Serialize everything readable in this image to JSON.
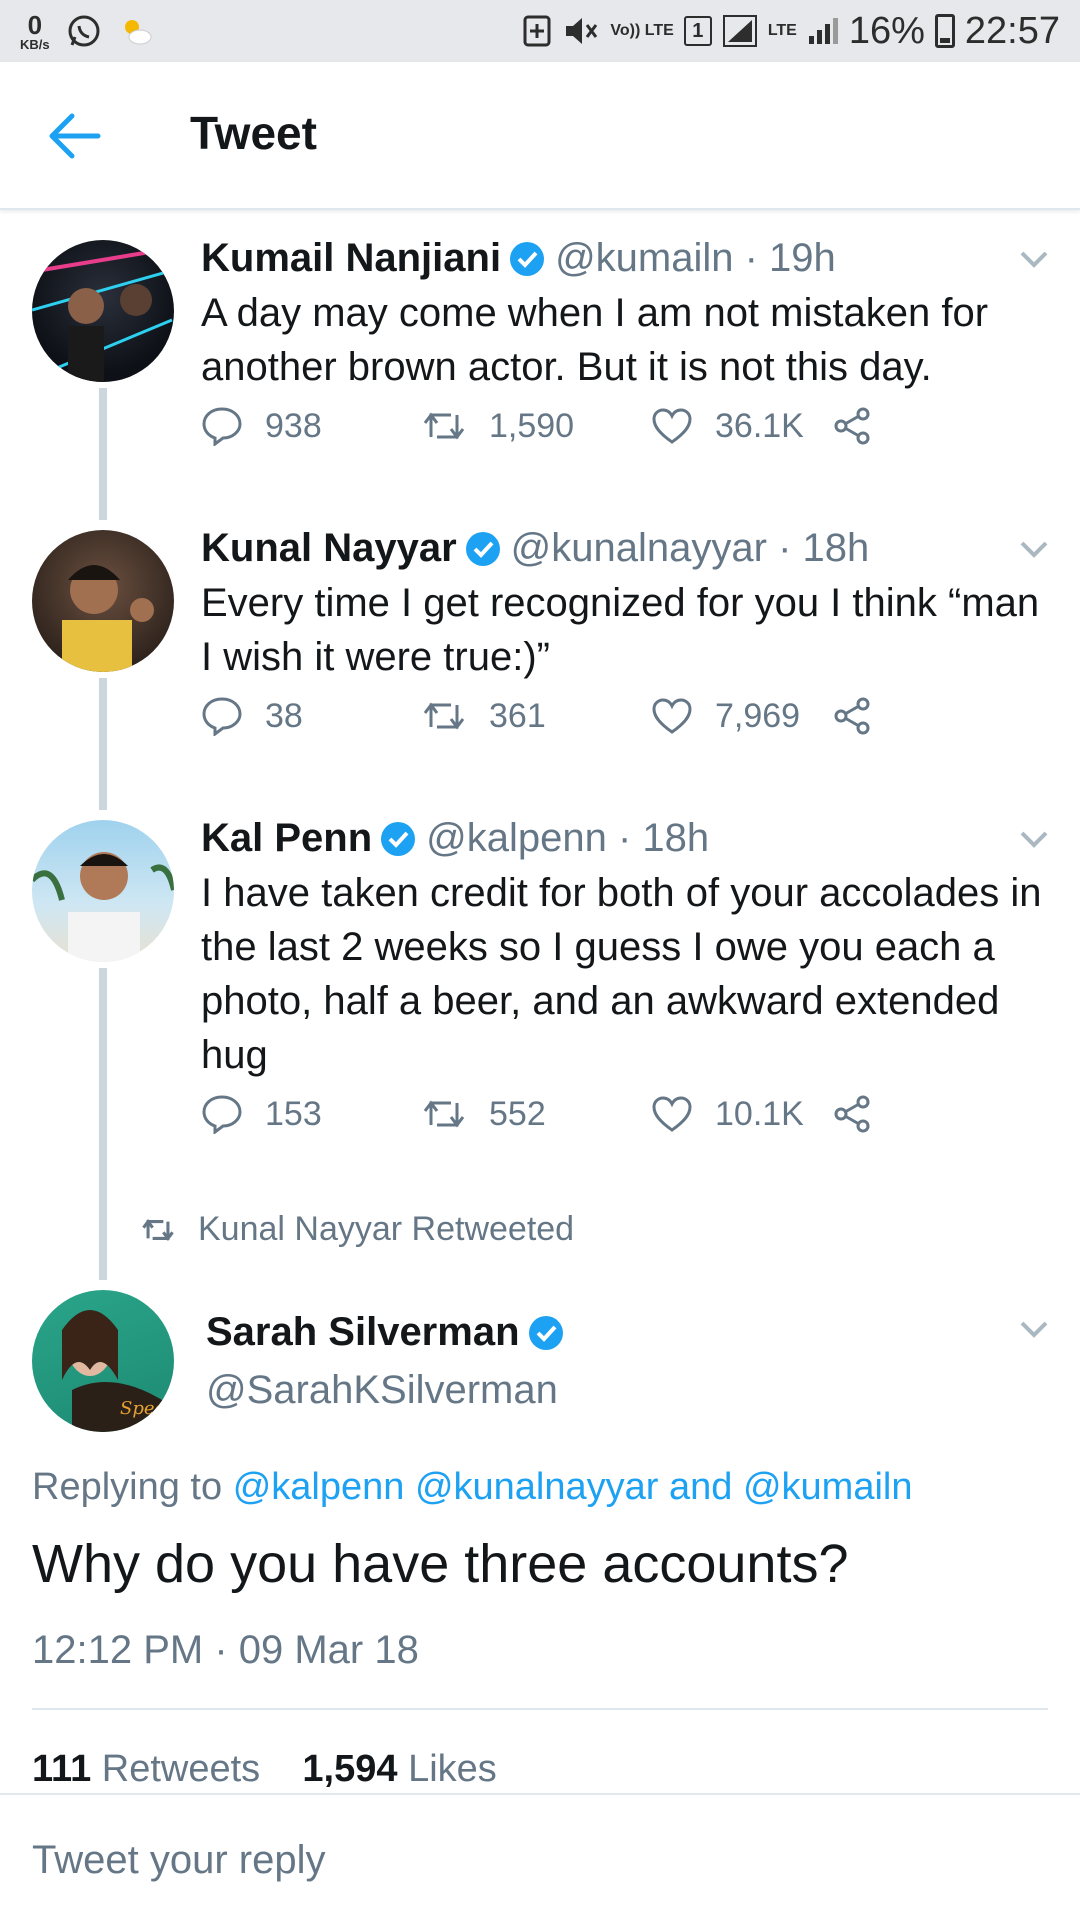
{
  "status_bar": {
    "net_speed_value": "0",
    "net_speed_unit": "KB/s",
    "volte": "Vo)) LTE",
    "sim": "1",
    "network": "LTE",
    "battery": "16%",
    "time": "22:57"
  },
  "header": {
    "title": "Tweet"
  },
  "thread": [
    {
      "name": "Kumail Nanjiani",
      "handle": "@kumailn · 19h",
      "text": "A day may come when I am not mistaken for another brown actor. But it is not this day.",
      "replies": "938",
      "retweets": "1,590",
      "likes": "36.1K"
    },
    {
      "name": "Kunal Nayyar",
      "handle": "@kunalnayyar · 18h",
      "text": "Every time I get recognized for you I think “man I wish it were true:)”",
      "replies": "38",
      "retweets": "361",
      "likes": "7,969"
    },
    {
      "name": "Kal Penn",
      "handle": "@kalpenn · 18h",
      "text": "I have taken credit for both of your accolades in the last 2 weeks so I guess I owe you each a photo, half a beer, and an awkward extended hug",
      "replies": "153",
      "retweets": "552",
      "likes": "10.1K"
    }
  ],
  "retweeted_by": "Kunal Nayyar Retweeted",
  "main_tweet": {
    "name": "Sarah Silverman",
    "handle": "@SarahKSilverman",
    "replying_prefix": "Replying to",
    "mentions": [
      "@kalpenn",
      "@kunalnayyar",
      "@kumailn"
    ],
    "replying_and": "and",
    "text": "Why do you have three accounts?",
    "timestamp": "12:12 PM · 09 Mar 18",
    "retweet_count": "111",
    "retweet_label": "Retweets",
    "like_count": "1,594",
    "like_label": "Likes"
  },
  "reply_placeholder": "Tweet your reply",
  "colors": {
    "accent": "#1da1f2",
    "muted": "#657786",
    "text": "#14171a",
    "line": "#ccd6dd"
  }
}
